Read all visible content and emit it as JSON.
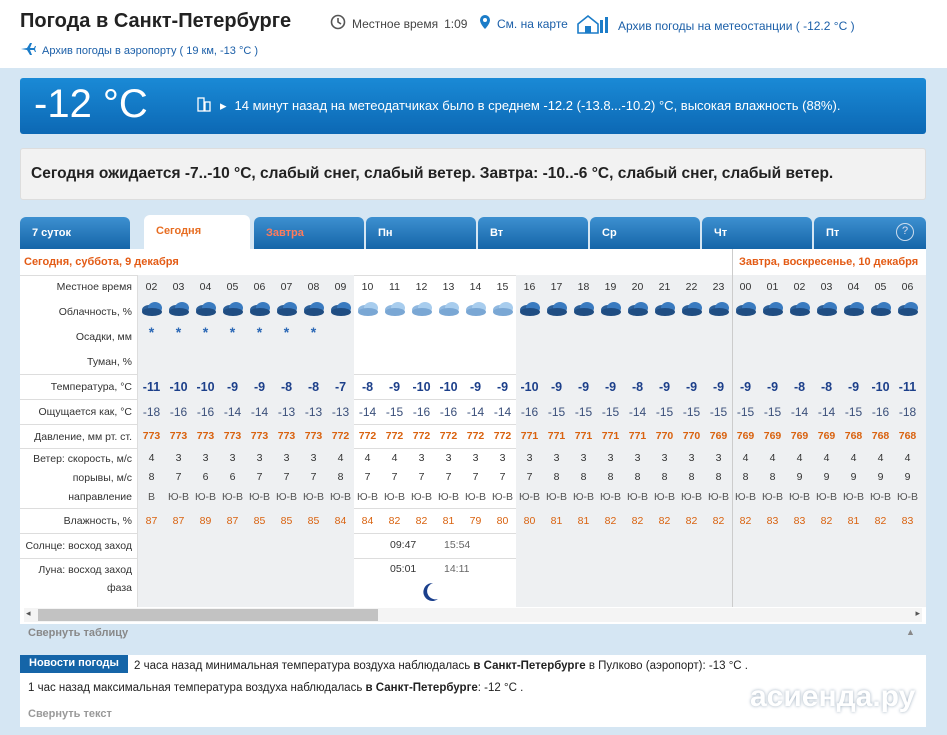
{
  "header": {
    "title": "Погода в Санкт-Петербурге",
    "local_time_label": "Местное время",
    "local_time": "1:09",
    "map_link": "См. на карте",
    "archive_station": "Архив погоды на метеостанции ( -12.2 °C )",
    "archive_airport": "Архив погоды в аэропорту ( 19 км, -13 °C )"
  },
  "now": {
    "temp": "-12 °C",
    "details": "14 минут назад на метеодатчиках было в среднем -12.2 (-13.8...-10.2) °C, высокая влажность (88%)."
  },
  "forecast_text": "Сегодня ожидается -7..-10 °C, слабый снег, слабый ветер. Завтра: -10..-6 °C, слабый снег, слабый ветер.",
  "tabs": [
    {
      "label": "7 суток"
    },
    {
      "label": "Сегодня"
    },
    {
      "label": "Завтра"
    },
    {
      "label": "Пн"
    },
    {
      "label": "Вт"
    },
    {
      "label": "Ср"
    },
    {
      "label": "Чт"
    },
    {
      "label": "Пт"
    }
  ],
  "help": "?",
  "day_labels": {
    "today": "Сегодня, суббота, 9 декабря",
    "tomorrow": "Завтра, воскресенье, 10 декабря"
  },
  "row_labels": {
    "time": "Местное время",
    "clouds": "Облачность, %",
    "precip": "Осадки, мм",
    "fog": "Туман, %",
    "temp": "Температура, °C",
    "feels": "Ощущается как, °C",
    "pressure": "Давление, мм рт. ст.",
    "wind": "Ветер: скорость, м/с",
    "gusts": "порывы, м/с",
    "dir": "направление",
    "humidity": "Влажность, %",
    "sun": "Солнце: восход заход",
    "moon": "Луна: восход заход",
    "phase": "фаза"
  },
  "hours": [
    "02",
    "03",
    "04",
    "05",
    "06",
    "07",
    "08",
    "09",
    "10",
    "11",
    "12",
    "13",
    "14",
    "15",
    "16",
    "17",
    "18",
    "19",
    "20",
    "21",
    "22",
    "23",
    "00",
    "01",
    "02",
    "03",
    "04",
    "05",
    "06"
  ],
  "snow": [
    "*",
    "*",
    "*",
    "*",
    "*",
    "*",
    "*",
    "",
    "",
    "",
    "",
    "",
    "",
    "",
    "",
    "",
    "",
    "",
    "",
    "",
    "",
    "",
    "",
    "",
    "",
    "",
    "",
    "",
    ""
  ],
  "temperature": [
    "-11",
    "-10",
    "-10",
    "-9",
    "-9",
    "-8",
    "-8",
    "-7",
    "-8",
    "-9",
    "-10",
    "-10",
    "-9",
    "-9",
    "-10",
    "-9",
    "-9",
    "-9",
    "-8",
    "-9",
    "-9",
    "-9",
    "-9",
    "-9",
    "-8",
    "-8",
    "-9",
    "-10",
    "-11"
  ],
  "feels": [
    "-18",
    "-16",
    "-16",
    "-14",
    "-14",
    "-13",
    "-13",
    "-13",
    "-14",
    "-15",
    "-16",
    "-16",
    "-14",
    "-14",
    "-16",
    "-15",
    "-15",
    "-15",
    "-14",
    "-15",
    "-15",
    "-15",
    "-15",
    "-15",
    "-14",
    "-14",
    "-15",
    "-16",
    "-18"
  ],
  "pressure": [
    "773",
    "773",
    "773",
    "773",
    "773",
    "773",
    "773",
    "772",
    "772",
    "772",
    "772",
    "772",
    "772",
    "772",
    "771",
    "771",
    "771",
    "771",
    "771",
    "770",
    "770",
    "769",
    "769",
    "769",
    "769",
    "769",
    "768",
    "768",
    "768"
  ],
  "wind": [
    "4",
    "3",
    "3",
    "3",
    "3",
    "3",
    "3",
    "4",
    "4",
    "4",
    "3",
    "3",
    "3",
    "3",
    "3",
    "3",
    "3",
    "3",
    "3",
    "3",
    "3",
    "3",
    "4",
    "4",
    "4",
    "4",
    "4",
    "4",
    "4"
  ],
  "gusts": [
    "8",
    "7",
    "6",
    "6",
    "7",
    "7",
    "7",
    "8",
    "7",
    "7",
    "7",
    "7",
    "7",
    "7",
    "7",
    "8",
    "8",
    "8",
    "8",
    "8",
    "8",
    "8",
    "8",
    "8",
    "9",
    "9",
    "9",
    "9",
    "9"
  ],
  "direction": [
    "В",
    "Ю-В",
    "Ю-В",
    "Ю-В",
    "Ю-В",
    "Ю-В",
    "Ю-В",
    "Ю-В",
    "Ю-В",
    "Ю-В",
    "Ю-В",
    "Ю-В",
    "Ю-В",
    "Ю-В",
    "Ю-В",
    "Ю-В",
    "Ю-В",
    "Ю-В",
    "Ю-В",
    "Ю-В",
    "Ю-В",
    "Ю-В",
    "Ю-В",
    "Ю-В",
    "Ю-В",
    "Ю-В",
    "Ю-В",
    "Ю-В",
    "Ю-В"
  ],
  "humidity": [
    "87",
    "87",
    "89",
    "87",
    "85",
    "85",
    "85",
    "84",
    "84",
    "82",
    "82",
    "81",
    "79",
    "80",
    "80",
    "81",
    "81",
    "82",
    "82",
    "82",
    "82",
    "82",
    "82",
    "83",
    "83",
    "82",
    "81",
    "82",
    "83"
  ],
  "sun": {
    "rise": "09:47",
    "set": "15:54"
  },
  "moon": {
    "rise": "05:01",
    "set": "14:11"
  },
  "collapse_table": "Свернуть таблицу",
  "news": {
    "tab": "Новости погоды",
    "line1_pre": "2 часа назад минимальная температура воздуха наблюдалась ",
    "line1_bold": "в Санкт-Петербурге",
    "line1_post": " в Пулково (аэропорт): -13 °C .",
    "line2_pre": "1 час назад максимальная температура воздуха наблюдалась ",
    "line2_bold": "в Санкт-Петербурге",
    "line2_post": ": -12 °C .",
    "collapse": "Свернуть текст"
  },
  "watermark": "асиенда.ру",
  "colors": {
    "accent_blue": "#1565a8",
    "orange": "#e76d22",
    "pressure": "#d9620f",
    "temp": "#1c3f8a"
  }
}
